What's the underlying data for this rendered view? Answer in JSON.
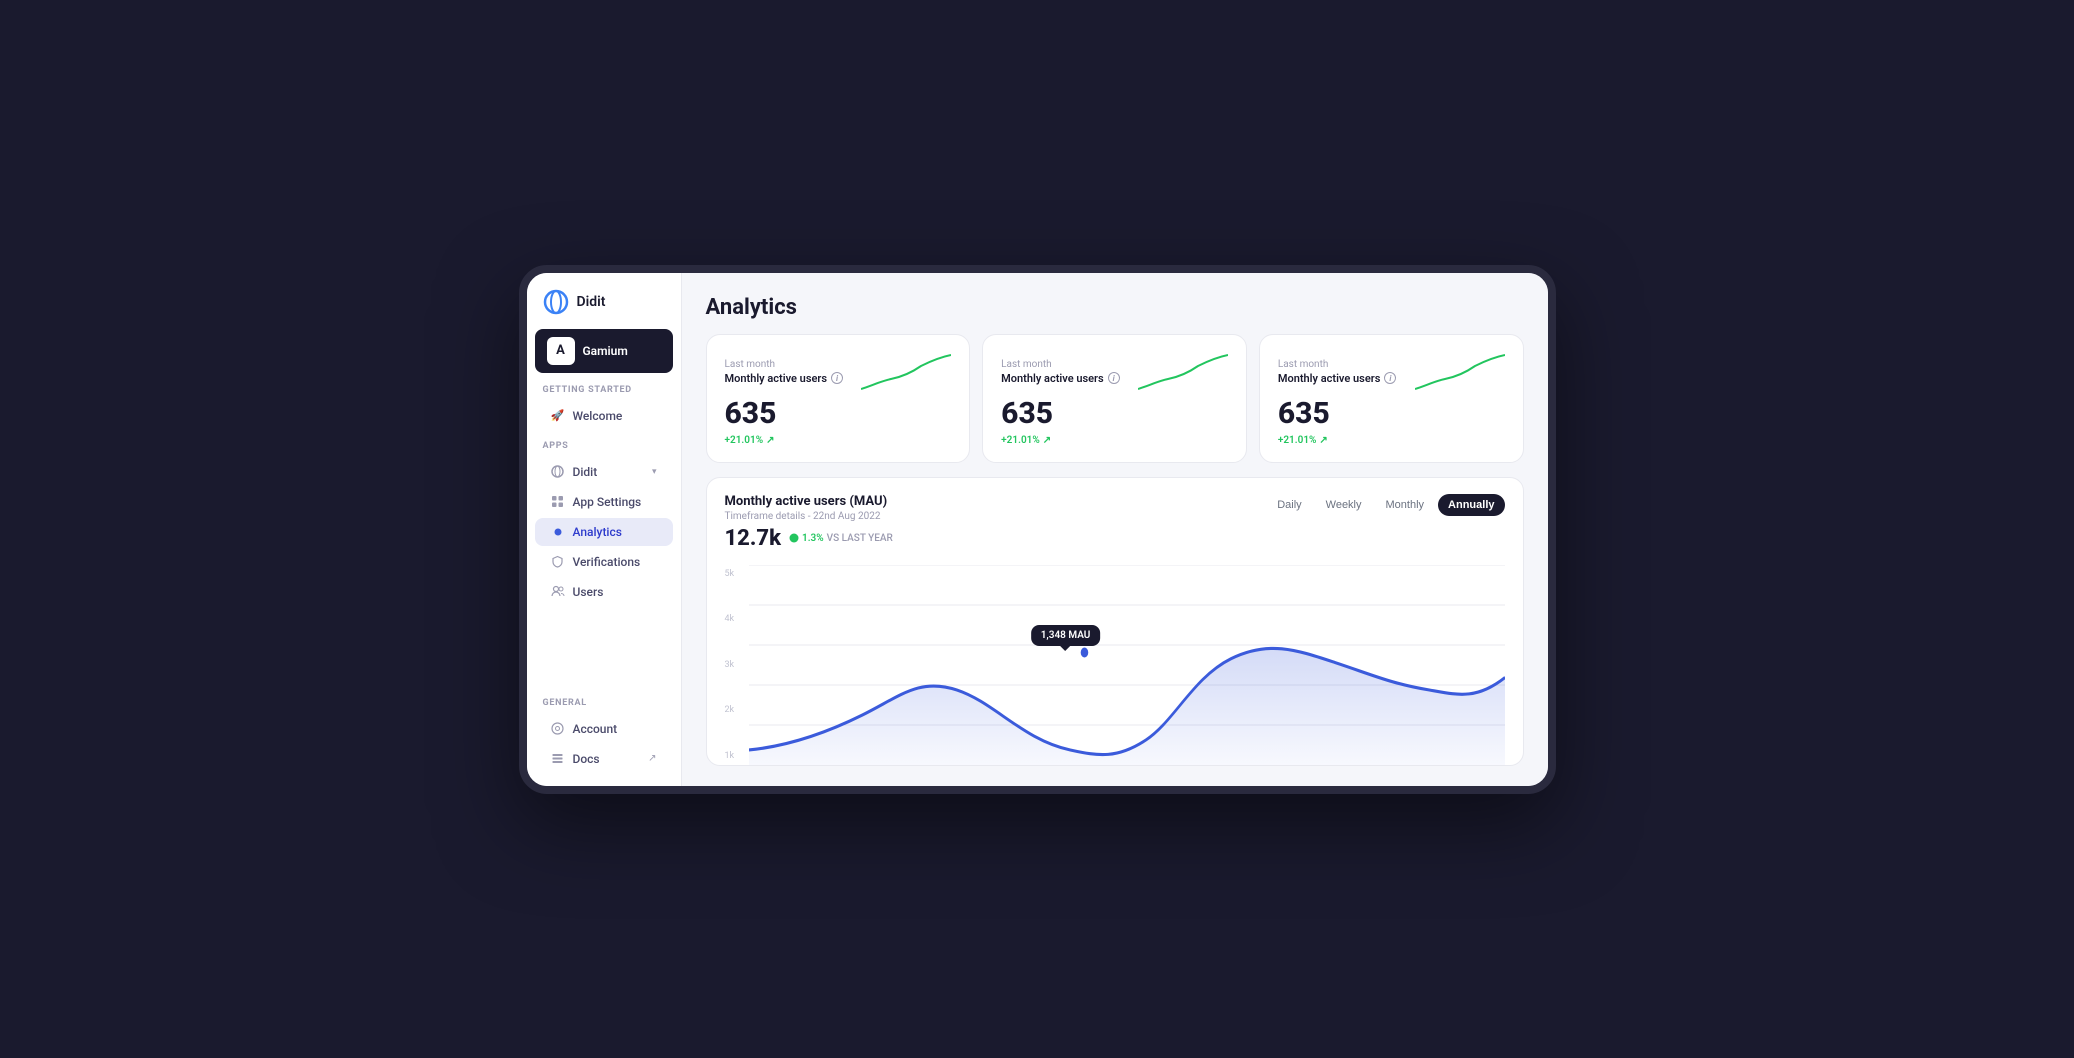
{
  "device": {
    "camera_notch": true
  },
  "sidebar": {
    "logo": {
      "text": "Didit"
    },
    "org": {
      "name": "Gamium",
      "avatar_letter": "A"
    },
    "sections": [
      {
        "label": "GETTING STARTED",
        "items": [
          {
            "id": "welcome",
            "label": "Welcome",
            "icon": "rocket",
            "active": false
          }
        ]
      },
      {
        "label": "APPS",
        "items": [
          {
            "id": "didit-app",
            "label": "Didit",
            "icon": "circle",
            "has_chevron": true,
            "active": false
          },
          {
            "id": "app-settings",
            "label": "App Settings",
            "icon": "grid",
            "active": false
          },
          {
            "id": "analytics",
            "label": "Analytics",
            "icon": "dot",
            "active": true
          },
          {
            "id": "verifications",
            "label": "Verifications",
            "icon": "shield",
            "active": false
          },
          {
            "id": "users",
            "label": "Users",
            "icon": "users",
            "active": false
          }
        ]
      },
      {
        "label": "GENERAL",
        "items": [
          {
            "id": "account",
            "label": "Account",
            "icon": "circle-outline",
            "active": false
          },
          {
            "id": "docs",
            "label": "Docs",
            "icon": "stack",
            "has_external": true,
            "active": false
          }
        ]
      }
    ]
  },
  "main": {
    "page_title": "Analytics",
    "stat_cards": [
      {
        "period": "Last month",
        "metric_label": "Monthly active users",
        "value": "635",
        "change": "+21.01%",
        "change_direction": "up"
      },
      {
        "period": "Last month",
        "metric_label": "Monthly active users",
        "value": "635",
        "change": "+21.01%",
        "change_direction": "up"
      },
      {
        "period": "Last month",
        "metric_label": "Monthly active users",
        "value": "635",
        "change": "+21.01%",
        "change_direction": "up"
      }
    ],
    "mau_chart": {
      "title": "Monthly active users (MAU)",
      "subtitle": "Timeframe details - 22nd Aug 2022",
      "big_value": "12.7k",
      "change_pct": "1.3%",
      "vs_label": "VS LAST YEAR",
      "tooltip_label": "1,348 MAU",
      "y_labels": [
        "5k",
        "4k",
        "3k",
        "2k",
        "1k"
      ],
      "timeframe_options": [
        "Daily",
        "Weekly",
        "Monthly",
        "Annually"
      ],
      "active_timeframe": "Annually"
    }
  }
}
